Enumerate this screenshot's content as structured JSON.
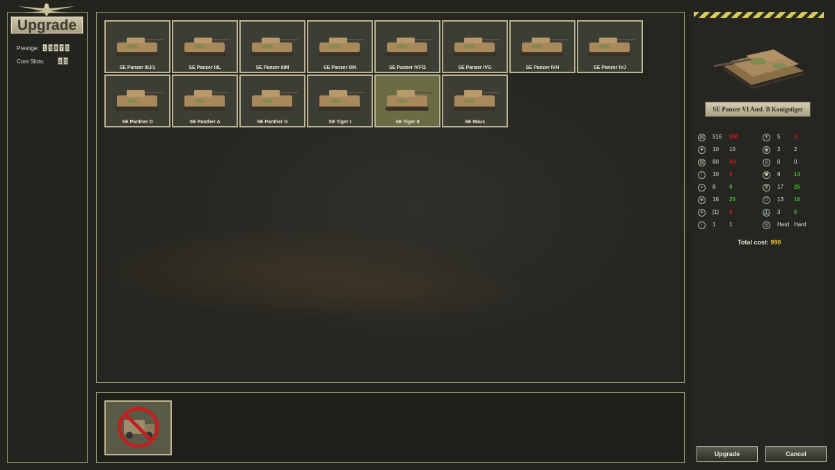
{
  "screen_title": "Upgrade",
  "prestige": {
    "label": "Prestige:",
    "digits": [
      "1",
      "3",
      "8",
      "7",
      "3"
    ]
  },
  "core_slots": {
    "label": "Core Slots:",
    "digits": [
      "4",
      "0"
    ]
  },
  "units": [
    {
      "name": "SE Panzer IIIJ/1"
    },
    {
      "name": "SE Panzer IIIL"
    },
    {
      "name": "SE Panzer IIIM"
    },
    {
      "name": "SE Panzer IIIN"
    },
    {
      "name": "SE Panzer IVF/2"
    },
    {
      "name": "SE Panzer IVG"
    },
    {
      "name": "SE Panzer IVH"
    },
    {
      "name": "SE Panzer IVJ"
    },
    {
      "name": "SE Panther D"
    },
    {
      "name": "SE Panther A"
    },
    {
      "name": "SE Panther G"
    },
    {
      "name": "SE Tiger I"
    },
    {
      "name": "SE Tiger II",
      "selected": true
    },
    {
      "name": "SE Maus"
    }
  ],
  "selected_unit": {
    "name": "SE Panzer VI Ausf. B Konigstiger"
  },
  "stats": {
    "left": [
      {
        "icon": "ammo-icon",
        "a": "516",
        "b": "990",
        "b_color": "red"
      },
      {
        "icon": "heart-icon",
        "a": "10",
        "b": "10",
        "b_color": ""
      },
      {
        "icon": "fuel-icon",
        "a": "80",
        "b": "43",
        "b_color": "red"
      },
      {
        "icon": "shells-icon",
        "a": "10",
        "b": "6",
        "b_color": "red"
      },
      {
        "icon": "soft-attack-icon",
        "a": "8",
        "b": "9",
        "b_color": "green"
      },
      {
        "icon": "hard-attack-icon",
        "a": "16",
        "b": "25",
        "b_color": "green"
      },
      {
        "icon": "air-attack-icon",
        "a": "[1]",
        "b": "0",
        "b_color": "red"
      },
      {
        "icon": "range-icon",
        "a": "1",
        "b": "1",
        "b_color": ""
      }
    ],
    "right": [
      {
        "icon": "movement-icon",
        "a": "5",
        "b": "3",
        "b_color": "red"
      },
      {
        "icon": "spotting-icon",
        "a": "2",
        "b": "2",
        "b_color": ""
      },
      {
        "icon": "initiative-icon",
        "a": "0",
        "b": "0",
        "b_color": ""
      },
      {
        "icon": "ground-defense-icon",
        "a": "9",
        "b": "14",
        "b_color": "green"
      },
      {
        "icon": "close-defense-icon",
        "a": "17",
        "b": "26",
        "b_color": "green"
      },
      {
        "icon": "air-defense-icon",
        "a": "13",
        "b": "18",
        "b_color": "green"
      },
      {
        "icon": "naval-icon",
        "a": "3",
        "b": "5",
        "b_color": "green"
      },
      {
        "icon": "target-type-icon",
        "a": "Hard",
        "b": "Hard",
        "b_color": ""
      }
    ]
  },
  "total_cost": {
    "label": "Total cost:",
    "value": "990"
  },
  "buttons": {
    "upgrade": "Upgrade",
    "cancel": "Cancel"
  },
  "colors": {
    "frame": "#bcb592",
    "gold": "#e8c33a",
    "red": "#d41616",
    "green": "#3bbf2a"
  }
}
